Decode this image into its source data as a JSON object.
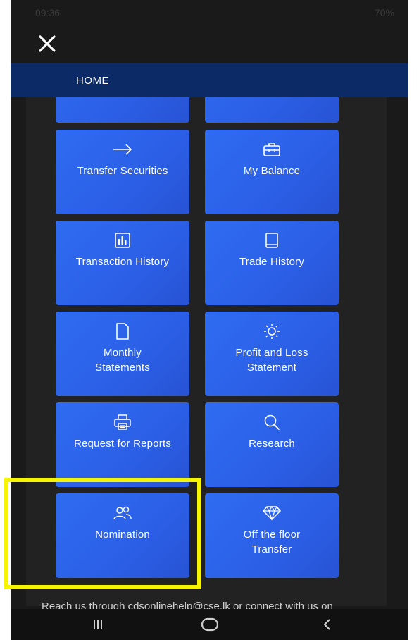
{
  "status_bar": {
    "time": "09:36",
    "indicators": "70%"
  },
  "header": {
    "close_icon": "close-icon"
  },
  "nav": {
    "home_label": "HOME"
  },
  "tiles": [
    {
      "name": "transfer-securities",
      "label": "Transfer Securities",
      "icon": "arrow-right-icon"
    },
    {
      "name": "my-balance",
      "label": "My Balance",
      "icon": "briefcase-icon"
    },
    {
      "name": "transaction-history",
      "label": "Transaction History",
      "icon": "bar-chart-icon"
    },
    {
      "name": "trade-history",
      "label": "Trade History",
      "icon": "book-icon"
    },
    {
      "name": "monthly-statements",
      "label": "Monthly Statements",
      "icon": "document-icon"
    },
    {
      "name": "profit-and-loss-statement",
      "label": "Profit and Loss Statement",
      "icon": "sun-icon"
    },
    {
      "name": "request-for-reports",
      "label": "Request for Reports",
      "icon": "printer-icon"
    },
    {
      "name": "research",
      "label": "Research",
      "icon": "search-icon"
    },
    {
      "name": "nomination",
      "label": "Nomination",
      "icon": "users-icon"
    },
    {
      "name": "off-the-floor-transfer",
      "label": "Off the floor Transfer",
      "icon": "diamond-icon"
    }
  ],
  "footer": {
    "text": "Reach us through cdsonlinehelp@cse.lk or connect with us on"
  },
  "colors": {
    "tile": "#2f6cf2",
    "nav": "#0b2a66",
    "highlight": "#f7f400"
  }
}
